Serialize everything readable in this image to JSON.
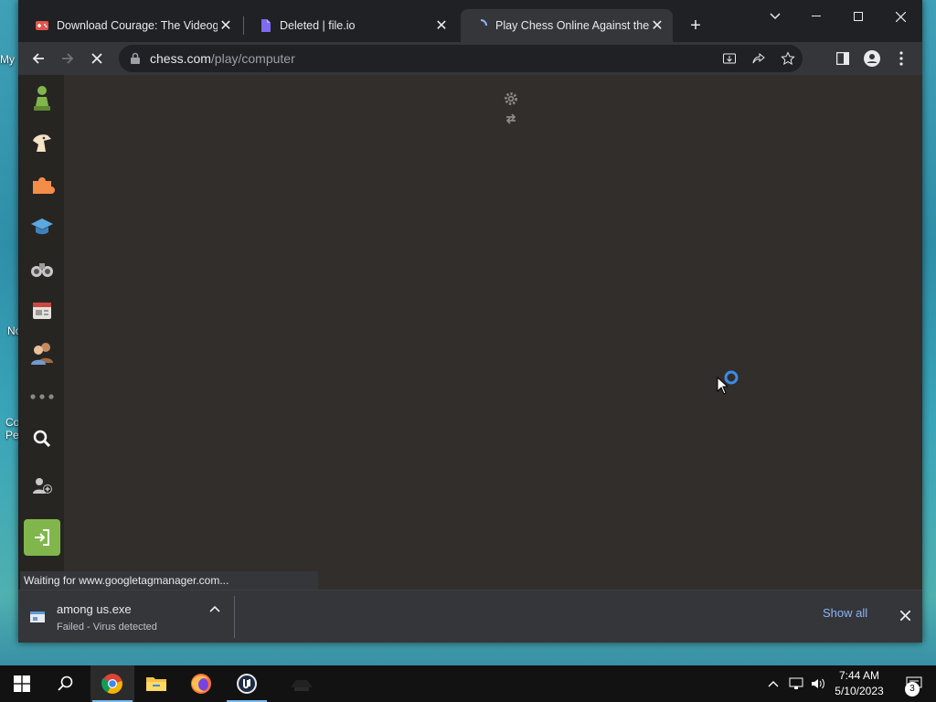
{
  "desktop": {
    "labels": [
      "My",
      "No",
      "Co",
      "Pe"
    ]
  },
  "browser": {
    "tabs": [
      {
        "title": "Download Courage: The Videoga",
        "favicon": "gamepad-icon",
        "active": false
      },
      {
        "title": "Deleted | file.io",
        "favicon": "fileio-icon",
        "active": false
      },
      {
        "title": "Play Chess Online Against the Co",
        "favicon": "loading-spinner-icon",
        "active": true
      }
    ],
    "address": {
      "host": "chess.com",
      "path": "/play/computer"
    },
    "status_text": "Waiting for www.googletagmanager.com...",
    "loading": true
  },
  "chess_sidebar": {
    "items": [
      {
        "name": "play-icon",
        "label": "Play"
      },
      {
        "name": "puzzles-icon",
        "label": "Puzzles"
      },
      {
        "name": "learn-icon",
        "label": "Learn"
      },
      {
        "name": "lessons-icon",
        "label": "Lessons"
      },
      {
        "name": "watch-icon",
        "label": "Watch"
      },
      {
        "name": "news-icon",
        "label": "News"
      },
      {
        "name": "social-icon",
        "label": "Social"
      },
      {
        "name": "more-icon",
        "label": "More"
      },
      {
        "name": "search-icon",
        "label": "Search"
      },
      {
        "name": "signup-icon",
        "label": "Sign Up"
      },
      {
        "name": "login-icon",
        "label": "Log In"
      }
    ]
  },
  "download_bar": {
    "file_name": "among us.exe",
    "status": "Failed - Virus detected",
    "show_all_label": "Show all"
  },
  "taskbar": {
    "apps": [
      "start-icon",
      "search-icon",
      "chrome-icon",
      "file-explorer-icon",
      "firefox-icon",
      "unreal-engine-icon",
      "app-icon"
    ],
    "clock_time": "7:44 AM",
    "clock_date": "5/10/2023",
    "notification_count": "3"
  },
  "colors": {
    "chess_bg": "#312e2b",
    "chess_green": "#81b64c",
    "link_blue": "#8ab4f8"
  }
}
